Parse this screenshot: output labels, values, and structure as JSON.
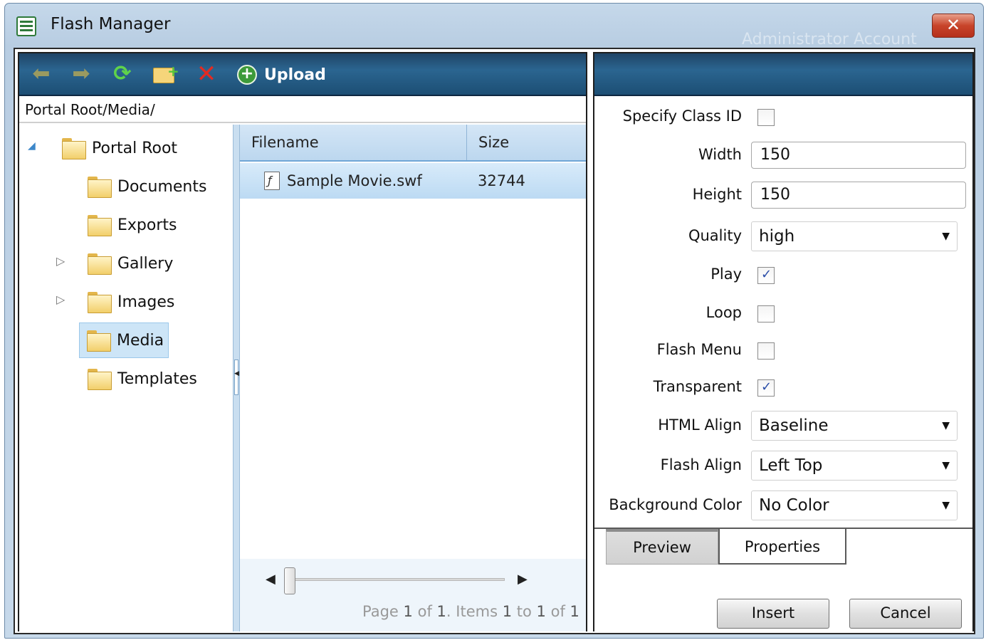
{
  "window": {
    "title": "Flash Manager",
    "watermark": "Administrator Account",
    "close_symbol": "✕"
  },
  "toolbar": {
    "back_icon": "arrow-back-icon",
    "forward_icon": "arrow-forward-icon",
    "refresh_icon": "refresh-icon",
    "new_folder_icon": "new-folder-icon",
    "delete_icon": "delete-icon",
    "upload_label": "Upload"
  },
  "path": "Portal Root/Media/",
  "tree": {
    "root": {
      "label": "Portal Root",
      "expanded": true
    },
    "children": [
      {
        "label": "Documents",
        "has_children": false,
        "selected": false
      },
      {
        "label": "Exports",
        "has_children": false,
        "selected": false
      },
      {
        "label": "Gallery",
        "has_children": true,
        "selected": false
      },
      {
        "label": "Images",
        "has_children": true,
        "selected": false
      },
      {
        "label": "Media",
        "has_children": false,
        "selected": true
      },
      {
        "label": "Templates",
        "has_children": false,
        "selected": false
      }
    ]
  },
  "grid": {
    "columns": [
      "Filename",
      "Size"
    ],
    "rows": [
      {
        "filename": "Sample Movie.swf",
        "size": "32744"
      }
    ],
    "pager": {
      "prefix": "Page",
      "page": "1",
      "of_label": "of",
      "pages": "1",
      "items_label": "Items",
      "from": "1",
      "to_label": "to",
      "to": "1",
      "of2_label": "of",
      "total": "1"
    }
  },
  "properties": {
    "specify_class_id": {
      "label": "Specify Class ID",
      "checked": false
    },
    "width": {
      "label": "Width",
      "value": "150"
    },
    "height": {
      "label": "Height",
      "value": "150"
    },
    "quality": {
      "label": "Quality",
      "value": "high"
    },
    "play": {
      "label": "Play",
      "checked": true
    },
    "loop": {
      "label": "Loop",
      "checked": false
    },
    "flash_menu": {
      "label": "Flash Menu",
      "checked": false
    },
    "transparent": {
      "label": "Transparent",
      "checked": true
    },
    "html_align": {
      "label": "HTML Align",
      "value": "Baseline"
    },
    "flash_align": {
      "label": "Flash Align",
      "value": "Left Top"
    },
    "background_color": {
      "label": "Background Color",
      "value": "No Color"
    }
  },
  "tabs": {
    "preview": "Preview",
    "properties": "Properties",
    "active": "properties"
  },
  "buttons": {
    "insert": "Insert",
    "cancel": "Cancel"
  },
  "colors": {
    "toolbar": "#2b6590",
    "selection": "#cde5f7",
    "close_button": "#c8442a"
  }
}
